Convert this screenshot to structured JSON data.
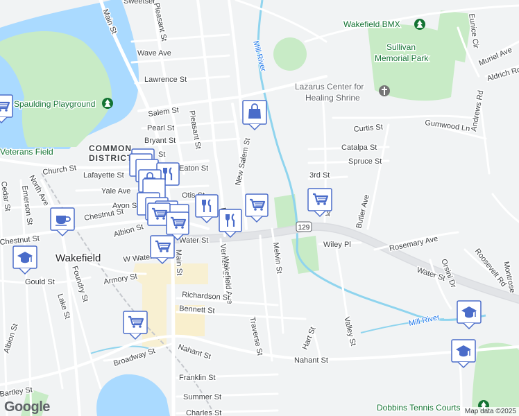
{
  "colors": {
    "water": "#aadaff",
    "park": "#c8ebc6",
    "land": "#f1f3f4",
    "road": "#ffffff",
    "highway": "#d7dadd",
    "marker": "#4a6cc9",
    "river": "#71c7e6",
    "urban": "#f7e6b6"
  },
  "places": {
    "wakefield_bmx": "Wakefield BMX",
    "sullivan_park_1": "Sullivan",
    "sullivan_park_2": "Memorial Park",
    "lazarus_1": "Lazarus Center for",
    "lazarus_2": "Healing Shrine",
    "spaulding": "Spaulding Playground",
    "veterans": "Veterans Field",
    "common_1": "COMMON",
    "common_2": "DISTRICT",
    "wakefield": "Wakefield",
    "dobbins": "Dobbins Tennis Courts"
  },
  "waterways": {
    "mill_river_top": "Mill River",
    "mill_river_bottom": "Mill River"
  },
  "streets": {
    "main": "Main St",
    "pleasant_top": "Pleasant St",
    "pleasant_mid": "Pleasant St",
    "wave": "Wave Ave",
    "lawrence": "Lawrence St",
    "salem": "Salem St",
    "pearl": "Pearl St",
    "bryant": "Bryant St",
    "church": "Church St",
    "lafayette": "Lafayette St",
    "yale": "Yale Ave",
    "avon": "Avon St",
    "chestnut": "Chestnut St",
    "albion_mid": "Albion St",
    "water_mid": "Water St",
    "w_water": "W Water St",
    "north": "North Ave",
    "cedar": "Cedar St",
    "emerson": "Emerson St",
    "chestnut_left": "Chestnut St",
    "gould": "Gould St",
    "foundry": "Foundry St",
    "lake": "Lake St",
    "albion_left": "Albion St",
    "armory": "Armory St",
    "main_lower": "Main St",
    "new_salem": "New Salem St",
    "wakefield_ave": "Wakefield Ave",
    "melvin": "Melvin St",
    "richardson": "Richardson St",
    "bennett": "Bennett St",
    "traverse": "Traverse St",
    "hart": "Hart St",
    "valley": "Valley St",
    "nahant_left": "Nahant St",
    "nahant_right": "Nahant St",
    "broadway": "Broadway St",
    "bartley": "Bartley St",
    "franklin": "Franklin St",
    "summer": "Summer St",
    "charles": "Charles St",
    "curtis": "Curtis St",
    "gumwood": "Gumwood Ln",
    "catalpa": "Catalpa St",
    "spruce": "Spruce St",
    "third": "3rd St",
    "butler": "Butler Ave",
    "wiley": "Wiley Pl",
    "rosemary": "Rosemary Ave",
    "water_right": "Water St",
    "orsini": "Orsini Dr",
    "roosevelt": "Roosevelt Rd",
    "montrose": "Montrose",
    "andrews": "Andrews Rd",
    "aldrich": "Aldrich Rd",
    "muriel": "Muriel Ave",
    "eunice": "Eunice Cir",
    "sweetser": "Sweetser",
    "heaton": "Eaton St",
    "otis": "Otis St",
    "vernon": "Vernon St",
    "park_ln": "Pa",
    "prospect": "Pr",
    "rte129": "129",
    "partial_st": "St"
  },
  "markers": [
    {
      "icon": "shopping-bag-icon"
    },
    {
      "icon": "grocery-cart-icon"
    },
    {
      "icon": "grocery-cart-icon"
    },
    {
      "icon": "restaurant-icon"
    },
    {
      "icon": "restaurant-icon"
    },
    {
      "icon": "grocery-cart-icon"
    },
    {
      "icon": "grocery-cart-icon"
    },
    {
      "icon": "grocery-cart-icon"
    },
    {
      "icon": "coffee-icon"
    },
    {
      "icon": "school-icon"
    },
    {
      "icon": "school-icon"
    },
    {
      "icon": "school-icon"
    },
    {
      "icon": "grocery-cart-icon"
    }
  ],
  "logo": "Google",
  "attribution": "Map data ©2025"
}
